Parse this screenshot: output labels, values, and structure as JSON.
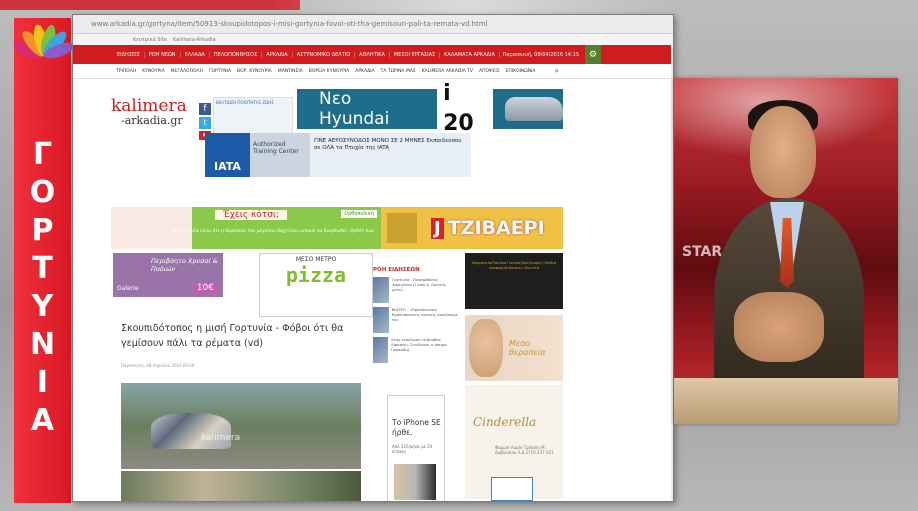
{
  "channel": {
    "vertical_title_letters": [
      "Γ",
      "Ο",
      "Ρ",
      "Τ",
      "Υ",
      "Ν",
      "Ι",
      "Α"
    ],
    "colors": {
      "banner": "#e3232c",
      "petals": [
        "#d92a7a",
        "#f2902b",
        "#f5c21c",
        "#7bbf3d",
        "#3aa6dd",
        "#8b5cc7"
      ]
    }
  },
  "browser": {
    "url": "www.arkadia.gr/gortyna/item/50913-skoupidotopos-i-misi-gortynia-fovoi-oti-tha-gemisoun-pali-ta-remata-vd.html",
    "bookmarks": [
      "Κεντρικό Site",
      "Kalimera-Arkadia"
    ]
  },
  "site": {
    "nav_items": [
      "ΕΙΔΗΣΕΙΣ",
      "ΡΟΗ ΝΕΩΝ",
      "ΕΛΛΑΔΑ",
      "ΠΕΛΟΠΟΝΝΗΣΟΣ",
      "ΑΡΚΑΔΙΑ",
      "ΑΣΤΥΝΟΜΙΚΟ ΔΕΛΤΙΟ",
      "ΑΘΛΗΤΙΚΑ",
      "ΜΕΣΟΙ ΕΡΓΑΣΙΑΣ",
      "ΚΑΛΑΜΑΤΑ ΑΡΚΑΔΙΑ"
    ],
    "date": "Παρασκευή, 08/04/2016 14:15",
    "subnav_items": [
      "ΤΡΙΠΟΛΗ",
      "ΚΥΝΟΥΡΙΑ",
      "ΜΕΓΑΛΟΠΟΛΗ",
      "ΓΟΡΤΥΝΙΑ",
      "ΒΟΡ. ΚΥΝΟΥΡΙΑ",
      "ΜΑΝΤΙΝΕΙΑ",
      "ΒΟΡΕΙΑ ΚΥΝΟΥΡΙΑ",
      "ΑΡΚΑΔΙΑ",
      "ΤΑ ΤΩΡΙΝΑ ΜΑΣ",
      "KALIMERA ARKADIA TV",
      "ΑΠΟΨΕΙΣ",
      "ΕΠΙΚΟΙΝΩΝΙΑ"
    ],
    "logo": {
      "line1": "kalimera",
      "line2": "-arkadia.gr"
    },
    "small_ad": "ΒΕΛΤΙΩΣΗ ΠΟΙΟΤΗΤΑΣ ΖΩΗΣ",
    "hyundai_ad": {
      "text": "Νεο Hyundai",
      "model": "i 20"
    },
    "iata_ad": {
      "logo": "IATA",
      "auth": "Authorized Training Center",
      "text": "ΓΙΝΕ ΑΕΡΟΣΥΝΟΔΟΣ ΜΟΝΟ ΣΕ 2 ΜΗΝΕΣ Εκπαιδεύσου σε ΟΛΑ τα Πτυχία της IATA"
    },
    "feet_ad": {
      "headline": "Έχεις κότσι;",
      "body": "Τα καλά νέα είναι ότι η θεραπεία του μεγάλου δαχτύλου μπορεί να διορθωθεί. Ορθότ πως",
      "brand": "Ορθοπεδική"
    },
    "tzivaeri_ad": {
      "j": "J",
      "name": "ΤΖΙΒΑΕΡΙ"
    },
    "galerie_ad": {
      "line1": "Περιβόητο Χρυσοί & Ποδιών",
      "line2": "Galerie",
      "badge": "10€"
    },
    "pizza_ad": {
      "top": "ΜΕΣΟ ΜΕΤΡΟ",
      "name": "pizza"
    },
    "article": {
      "title": "Σκουπιδότοπος η μισή Γορτυνία - Φόβοι ότι θα γεμίσουν πάλι τα ρέματα (vd)",
      "meta": "Παρασκευή, 08 Απριλίου 2016 09:08",
      "photo_caption": "kalimera"
    },
    "news_feed": {
      "title": "ΡΟΗ ΕΙΔΗΣΕΩΝ",
      "items": [
        {
          "text": "Γορτυνία - Παρεμβάσεις Αρχηγείου Ο Ισον & Ορεινής μετεί..."
        },
        {
          "text": "ΒΙΝΤΕΟ - «Προοδευτικό Καρδιοπολικής αγωγής αναλύουμε το»"
        },
        {
          "text": "Στην εκδήλωση «Κάλαβας Λάρισος» Συνέδριος η άσημα Γραπαδης"
        }
      ]
    },
    "iphone_ad": {
      "title": "Το iPhone SE ήρθε.",
      "sub": "Από 31€/μήνα με 24 άτοκες"
    },
    "right_ads": {
      "dark": "Φαρμακεία/Παιδικά Γιατροί/Καλ/Αγορές/ Μαθεσ Αναφορικά Κάποιες Ιδιωτικά",
      "spa": "Μεσο θεραπεία",
      "cinderella": "Cinderella",
      "cinderella_sub": "Φαρμ/κ Λαρ/κ Τρίπολη Μ. Δαβηκλίου Λ.Δ 2710 237 021"
    }
  },
  "video": {
    "studio_text": "STAR"
  }
}
